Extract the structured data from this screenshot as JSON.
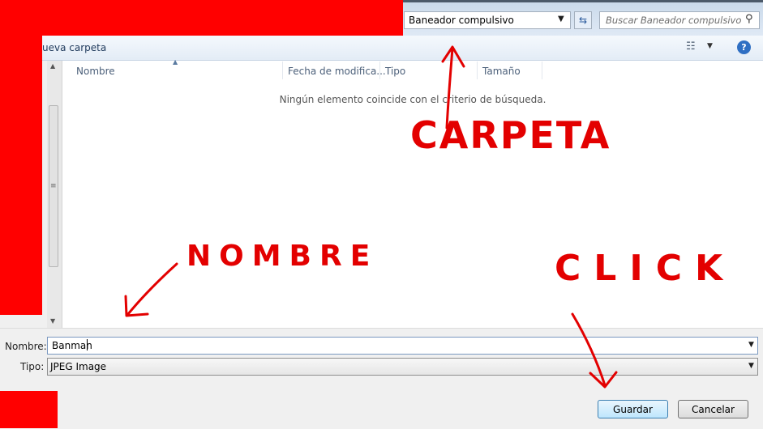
{
  "address": {
    "current_folder": "Baneador compulsivo"
  },
  "search": {
    "placeholder": "Buscar Baneador compulsivo"
  },
  "toolbar": {
    "new_folder_label": "ueva carpeta"
  },
  "file_list": {
    "columns": [
      "Nombre",
      "Fecha de modifica...",
      "Tipo",
      "Tamaño"
    ],
    "empty_message": "Ningún elemento coincide con el criterio de búsqueda."
  },
  "form": {
    "name_label": "Nombre:",
    "name_value": "Banman",
    "type_label": "Tipo:",
    "type_value": "JPEG Image"
  },
  "buttons": {
    "save": "Guardar",
    "cancel": "Cancelar"
  },
  "annotations": {
    "folder": "CARPETA",
    "name": "NOMBRE",
    "click": "CLICK"
  },
  "colors": {
    "annotation": "#e30000",
    "redaction": "#ff0000",
    "accent": "#3c7fb1"
  },
  "icons": [
    "refresh-icon",
    "search-icon",
    "view-options-icon",
    "help-icon"
  ]
}
